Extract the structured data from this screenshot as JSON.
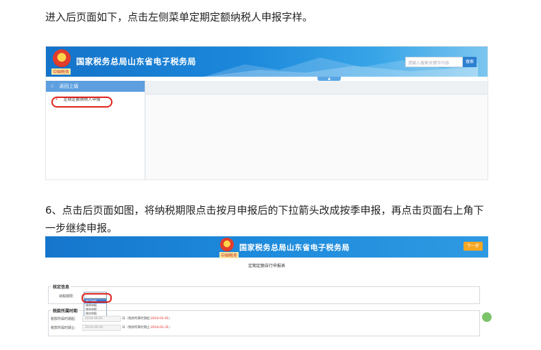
{
  "article": {
    "para1": "进入后页面如下，点击左侧菜单定期定额纳税人申报字样。",
    "para2": "6、点击后页面如图，将纳税期限点击按月申报后的下拉箭头改成按季申报，再点击页面右上角下一步继续申报。"
  },
  "shot1": {
    "site_title": "国家税务总局山东省电子税务局",
    "emblem_caption": "中国税务",
    "search_placeholder": "请输入搜索关键字内容",
    "search_button": "搜索",
    "collapse_arrow": "▲",
    "sidebar_head": "返回上级",
    "sidebar_head_icon": "☆",
    "sidebar_item": "定期定额纳税人申报",
    "sidebar_item_bullet": "•"
  },
  "shot2": {
    "site_title": "国家税务总局山东省电子税务局",
    "emblem_caption": "中国税务",
    "next_button": "下一步",
    "form_title": "定期定额自行申报表",
    "fieldset1_legend": "核定信息",
    "tax_period_label": "纳税期限:",
    "dropdown_options": [
      "按月申报",
      "按季申报",
      "按年申报",
      "按次申报"
    ],
    "fieldset2_legend": "税款所属时期",
    "start_label": "税款所属时期起:",
    "start_value": "2019-06-01",
    "start_note": "日（税款所属时期起:",
    "start_note_date": "2014-01-01",
    "start_note_close": "）",
    "end_label": "税款所属时期止:",
    "end_value": "2019-06-30",
    "end_note": "日（税款所属时期止:",
    "end_note_date": "2014-01-31",
    "end_note_close": "）"
  },
  "colors": {
    "banner_blue": "#1c88db",
    "highlight_red": "#e0201b",
    "next_orange": "#f5a623"
  }
}
